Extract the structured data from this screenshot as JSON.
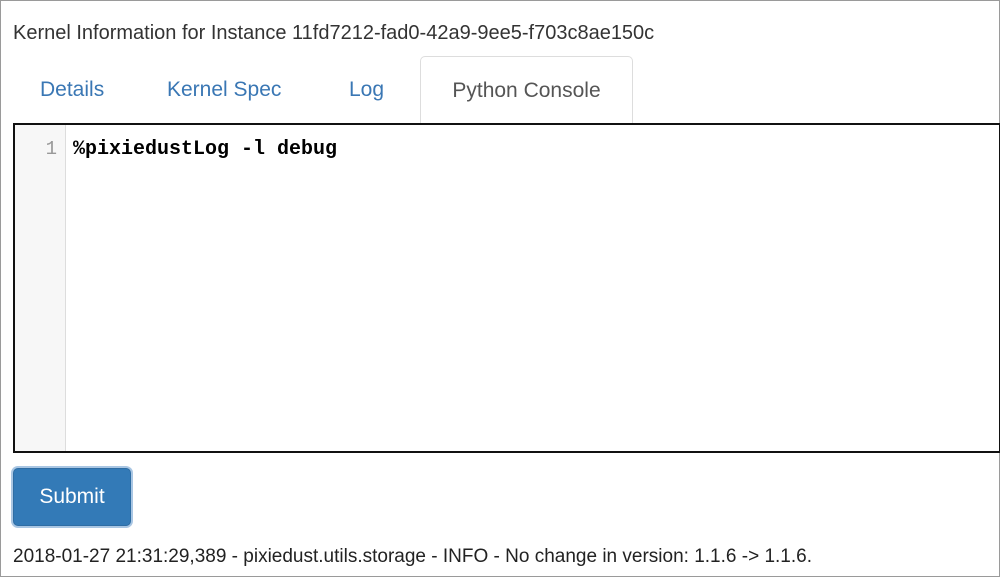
{
  "header": {
    "title": "Kernel Information for Instance 11fd7212-fad0-42a9-9ee5-f703c8ae150c"
  },
  "tabs": [
    {
      "label": "Details",
      "active": false
    },
    {
      "label": "Kernel Spec",
      "active": false
    },
    {
      "label": "Log",
      "active": false
    },
    {
      "label": "Python Console",
      "active": true
    }
  ],
  "editor": {
    "lines": [
      {
        "number": "1",
        "code": "%pixiedustLog -l debug"
      }
    ]
  },
  "actions": {
    "submit_label": "Submit"
  },
  "output": {
    "log_text": "2018-01-27 21:31:29,389 - pixiedust.utils.storage - INFO - No change in version: 1.1.6 -> 1.1.6."
  },
  "colors": {
    "tab_link": "#3a77b4",
    "button": "#337ab7"
  }
}
